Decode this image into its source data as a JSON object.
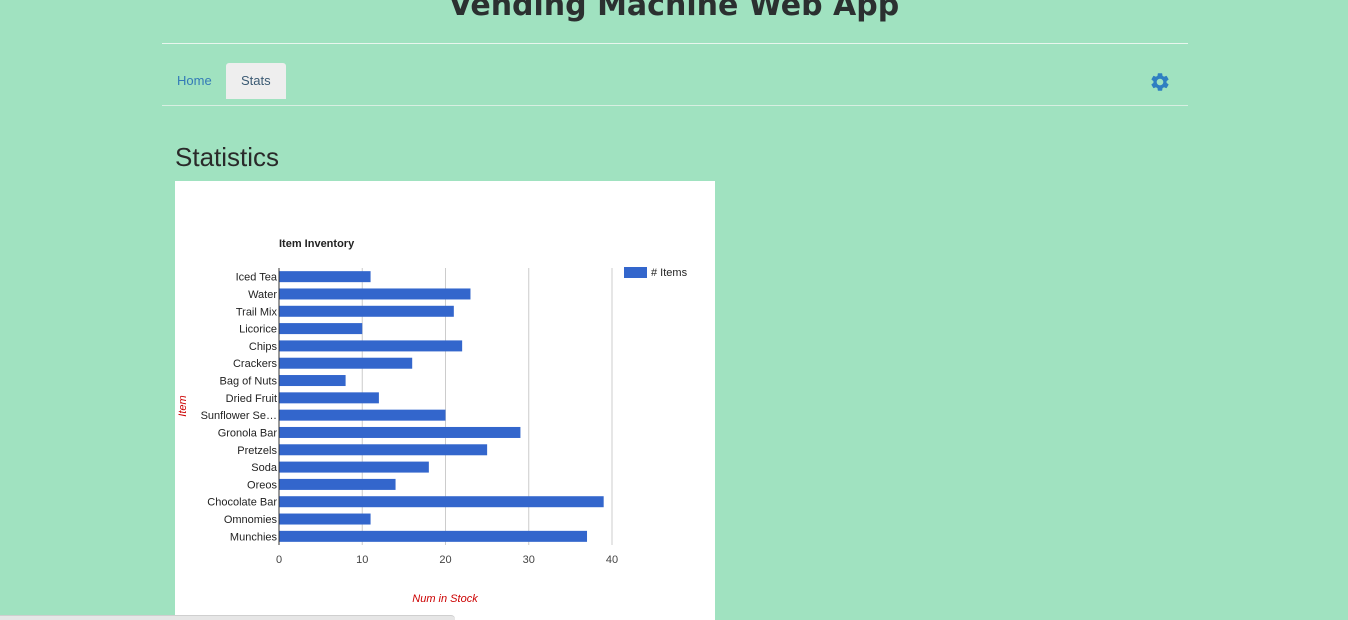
{
  "header": {
    "app_title": "Vending Machine Web App"
  },
  "nav": {
    "tabs": [
      {
        "label": "Home",
        "active": false
      },
      {
        "label": "Stats",
        "active": true
      }
    ],
    "settings_icon": "gear-icon",
    "link_color": "#337ab7",
    "settings_color": "#2f7fc1"
  },
  "main": {
    "heading": "Statistics"
  },
  "colors": {
    "page_background": "#a0e2c0",
    "bar_color": "#3366cc",
    "axis_title_color": "#cc0000"
  },
  "chart_data": {
    "type": "bar",
    "orientation": "horizontal",
    "title": "Item Inventory",
    "xlabel": "Num in Stock",
    "ylabel": "Item",
    "categories": [
      "Iced Tea",
      "Water",
      "Trail Mix",
      "Licorice",
      "Chips",
      "Crackers",
      "Bag of Nuts",
      "Dried Fruit",
      "Sunflower Se…",
      "Gronola Bar",
      "Pretzels",
      "Soda",
      "Oreos",
      "Chocolate Bar",
      "Omnomies",
      "Munchies"
    ],
    "series": [
      {
        "name": "# Items",
        "values": [
          11,
          23,
          21,
          10,
          22,
          16,
          8,
          12,
          20,
          29,
          25,
          18,
          14,
          39,
          11,
          37
        ]
      }
    ],
    "xlim": [
      0,
      40
    ],
    "x_ticks": [
      "0",
      "10",
      "20",
      "30",
      "40"
    ],
    "grid": true,
    "legend_position": "right"
  }
}
